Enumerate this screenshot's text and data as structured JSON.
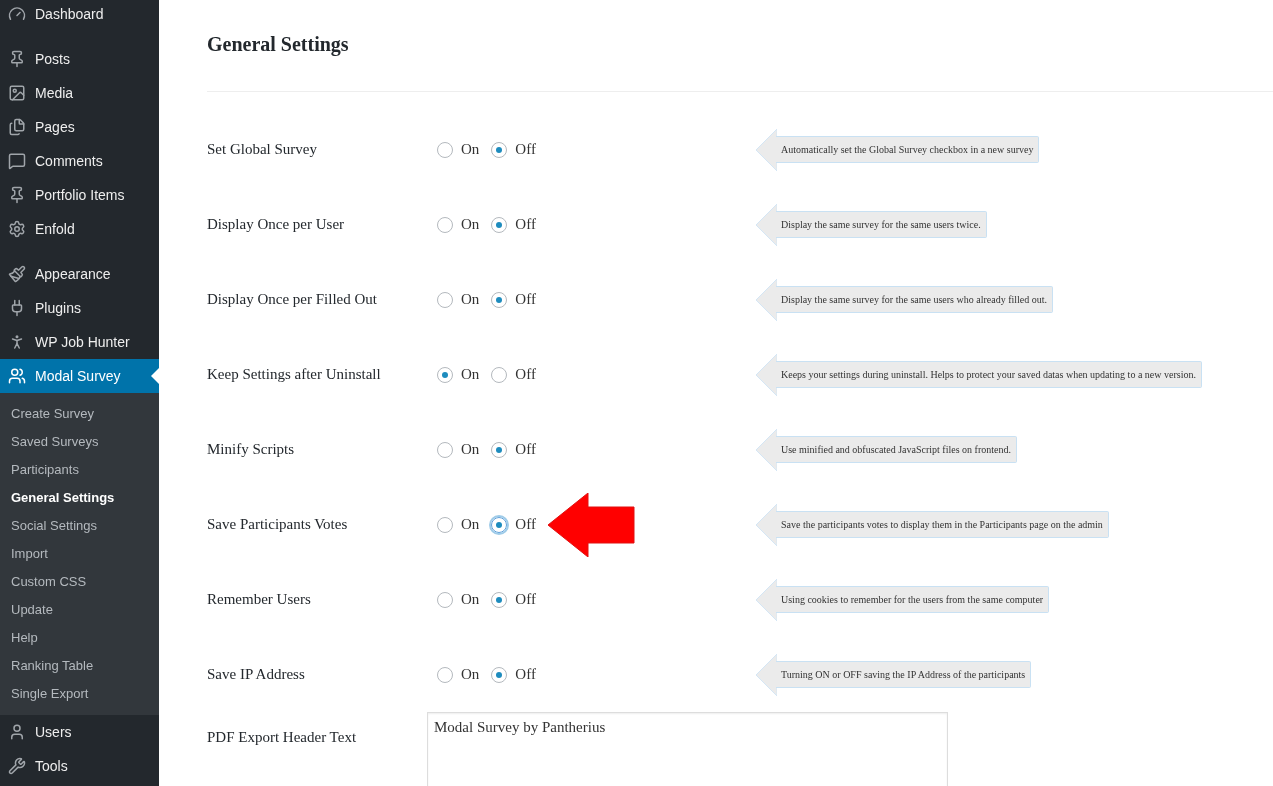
{
  "sidebar": {
    "sections": [
      {
        "items": [
          {
            "label": "Dashboard",
            "selected": false
          }
        ]
      },
      {
        "items": [
          {
            "label": "Posts",
            "selected": false
          },
          {
            "label": "Media",
            "selected": false
          },
          {
            "label": "Pages",
            "selected": false
          },
          {
            "label": "Comments",
            "selected": false
          },
          {
            "label": "Portfolio Items",
            "selected": false
          },
          {
            "label": "Enfold",
            "selected": false
          }
        ]
      },
      {
        "items": [
          {
            "label": "Appearance",
            "selected": false
          },
          {
            "label": "Plugins",
            "selected": false
          },
          {
            "label": "WP Job Hunter",
            "selected": false
          },
          {
            "label": "Modal Survey",
            "selected": true,
            "children": [
              {
                "label": "Create Survey",
                "selected": false
              },
              {
                "label": "Saved Surveys",
                "selected": false
              },
              {
                "label": "Participants",
                "selected": false
              },
              {
                "label": "General Settings",
                "selected": true
              },
              {
                "label": "Social Settings",
                "selected": false
              },
              {
                "label": "Import",
                "selected": false
              },
              {
                "label": "Custom CSS",
                "selected": false
              },
              {
                "label": "Update",
                "selected": false
              },
              {
                "label": "Help",
                "selected": false
              },
              {
                "label": "Ranking Table",
                "selected": false
              },
              {
                "label": "Single Export",
                "selected": false
              }
            ]
          },
          {
            "label": "Users",
            "selected": false
          },
          {
            "label": "Tools",
            "selected": false
          }
        ]
      }
    ]
  },
  "page": {
    "title": "General Settings",
    "settings": [
      {
        "label": "Set Global Survey",
        "options": [
          {
            "label": "On",
            "selected": false,
            "focused": false
          },
          {
            "label": "Off",
            "selected": true,
            "focused": false
          }
        ],
        "pointed": false,
        "hint": "Automatically set the Global Survey checkbox in a new survey"
      },
      {
        "label": "Display Once per User",
        "options": [
          {
            "label": "On",
            "selected": false,
            "focused": false
          },
          {
            "label": "Off",
            "selected": true,
            "focused": false
          }
        ],
        "pointed": false,
        "hint": "Display the same survey for the same users twice."
      },
      {
        "label": "Display Once per Filled Out",
        "options": [
          {
            "label": "On",
            "selected": false,
            "focused": false
          },
          {
            "label": "Off",
            "selected": true,
            "focused": false
          }
        ],
        "pointed": false,
        "hint": "Display the same survey for the same users who already filled out."
      },
      {
        "label": "Keep Settings after Uninstall",
        "options": [
          {
            "label": "On",
            "selected": true,
            "focused": false
          },
          {
            "label": "Off",
            "selected": false,
            "focused": false
          }
        ],
        "pointed": false,
        "hint": "Keeps your settings during uninstall. Helps to protect your saved datas when updating to a new version."
      },
      {
        "label": "Minify Scripts",
        "options": [
          {
            "label": "On",
            "selected": false,
            "focused": false
          },
          {
            "label": "Off",
            "selected": true,
            "focused": false
          }
        ],
        "pointed": false,
        "hint": "Use minified and obfuscated JavaScript files on frontend."
      },
      {
        "label": "Save Participants Votes",
        "options": [
          {
            "label": "On",
            "selected": false,
            "focused": false
          },
          {
            "label": "Off",
            "selected": true,
            "focused": true
          }
        ],
        "pointed": true,
        "hint": "Save the participants votes to display them in the Participants page on the admin"
      },
      {
        "label": "Remember Users",
        "options": [
          {
            "label": "On",
            "selected": false,
            "focused": false
          },
          {
            "label": "Off",
            "selected": true,
            "focused": false
          }
        ],
        "pointed": false,
        "hint": "Using cookies to remember for the users from the same computer"
      },
      {
        "label": "Save IP Address",
        "options": [
          {
            "label": "On",
            "selected": false,
            "focused": false
          },
          {
            "label": "Off",
            "selected": true,
            "focused": false
          }
        ],
        "pointed": false,
        "hint": "Turning ON or OFF saving the IP Address of the participants"
      }
    ],
    "pdf_header": {
      "label": "PDF Export Header Text",
      "value": "Modal Survey by Pantherius"
    }
  }
}
